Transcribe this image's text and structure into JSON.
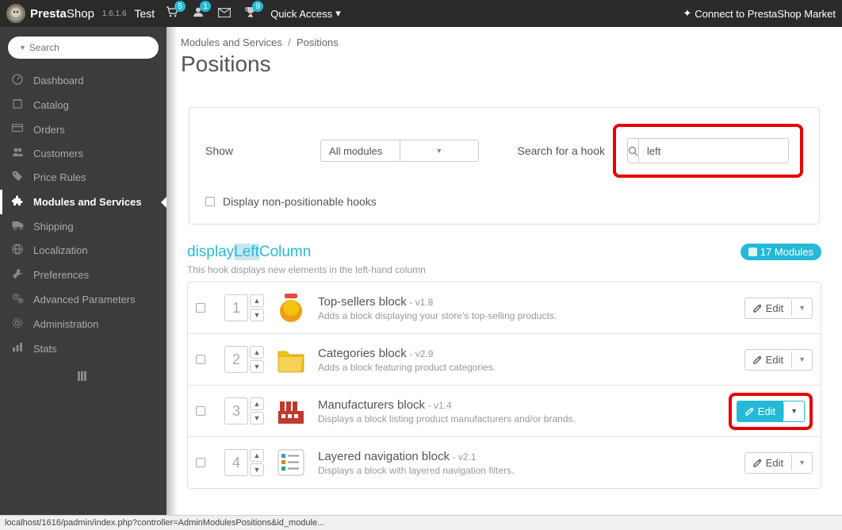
{
  "topbar": {
    "brand_a": "Presta",
    "brand_b": "Shop",
    "version": "1.6.1.6",
    "site_name": "Test",
    "cart_badge": "5",
    "user_badge": "1",
    "trophy_badge": "9",
    "quick_access": "Quick Access",
    "market": "Connect to PrestaShop Market"
  },
  "sidebar": {
    "search_placeholder": "Search",
    "items": [
      {
        "label": "Dashboard",
        "icon": "dashboard"
      },
      {
        "label": "Catalog",
        "icon": "book"
      },
      {
        "label": "Orders",
        "icon": "credit-card"
      },
      {
        "label": "Customers",
        "icon": "users"
      },
      {
        "label": "Price Rules",
        "icon": "tag"
      },
      {
        "label": "Modules and Services",
        "icon": "puzzle",
        "active": true
      },
      {
        "label": "Shipping",
        "icon": "truck"
      },
      {
        "label": "Localization",
        "icon": "globe"
      },
      {
        "label": "Preferences",
        "icon": "wrench"
      },
      {
        "label": "Advanced Parameters",
        "icon": "gears"
      },
      {
        "label": "Administration",
        "icon": "gear"
      },
      {
        "label": "Stats",
        "icon": "bar-chart"
      }
    ]
  },
  "breadcrumb": {
    "a": "Modules and Services",
    "b": "Positions"
  },
  "page_title": "Positions",
  "filter": {
    "show_label": "Show",
    "select_value": "All modules",
    "search_label": "Search for a hook",
    "search_value": "left",
    "checkbox_label": "Display non-positionable hooks"
  },
  "hook": {
    "title_a": "display",
    "title_b": "Left",
    "title_c": "Column",
    "desc": "This hook displays new elements in the left-hand column",
    "count": "17 Modules"
  },
  "modules": [
    {
      "pos": "1",
      "name": "Top-sellers block",
      "version": "- v1.8",
      "desc": "Adds a block displaying your store's top-selling products.",
      "icon_color": "#f39c12",
      "edit": "Edit"
    },
    {
      "pos": "2",
      "name": "Categories block",
      "version": "- v2.9",
      "desc": "Adds a block featuring product categories.",
      "icon_color": "#f1c40f",
      "edit": "Edit"
    },
    {
      "pos": "3",
      "name": "Manufacturers block",
      "version": "- v1.4",
      "desc": "Displays a block listing product manufacturers and/or brands.",
      "icon_color": "#c0392b",
      "edit": "Edit",
      "highlight": true
    },
    {
      "pos": "4",
      "name": "Layered navigation block",
      "version": "- v2.1",
      "desc": "Displays a block with layered navigation filters.",
      "icon_color": "#3498db",
      "edit": "Edit"
    }
  ],
  "statusbar": "localhost/1616/padmin/index.php?controller=AdminModulesPositions&id_module..."
}
